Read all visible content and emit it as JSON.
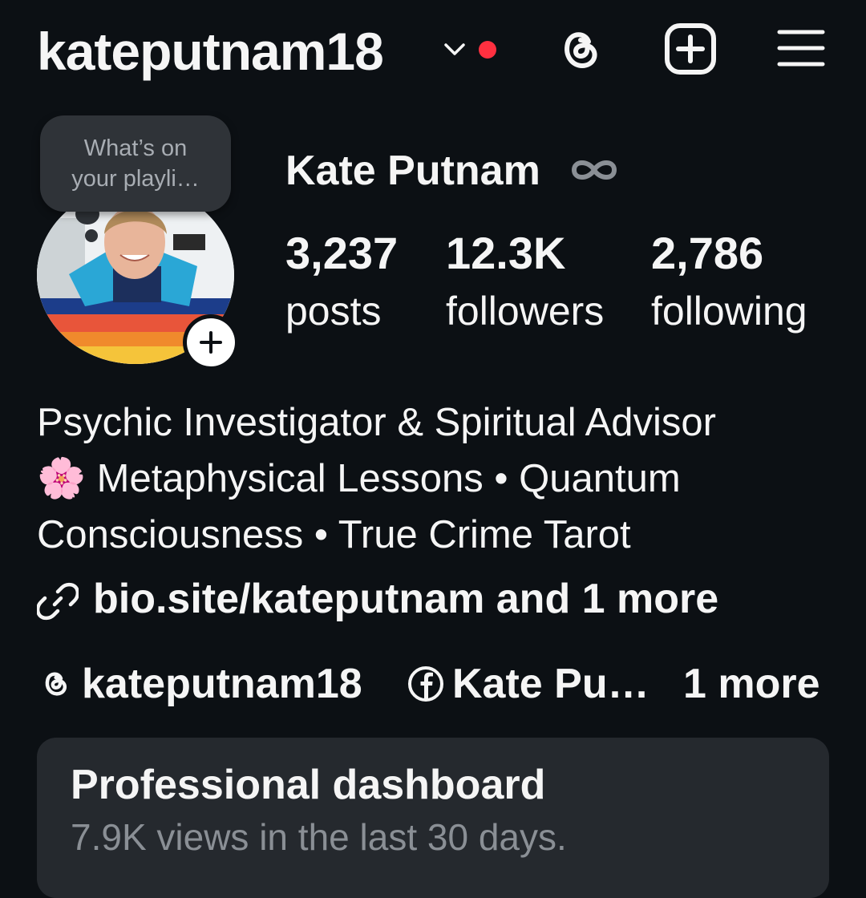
{
  "header": {
    "username": "kateputnam18",
    "has_notification_dot": true,
    "accent_red": "#ff3040"
  },
  "profile": {
    "note": "What’s on\nyour playli…",
    "display_name": "Kate Putnam",
    "badge_icon": "infinity-icon",
    "stats": [
      {
        "value": "3,237",
        "label": "posts"
      },
      {
        "value": "12.3K",
        "label": "followers"
      },
      {
        "value": "2,786",
        "label": "following"
      }
    ]
  },
  "bio": {
    "lines": [
      "Psychic Investigator & Spiritual Advisor",
      "🌸 Metaphysical Lessons • Quantum",
      "Consciousness • True Crime Tarot"
    ],
    "link": "bio.site/kateputnam and 1 more"
  },
  "social": {
    "threads_handle": "kateputnam18",
    "facebook_name": "Kate Pu…",
    "more": "1 more"
  },
  "dashboard": {
    "title": "Professional dashboard",
    "subtitle": "7.9K views in the last 30 days."
  },
  "colors": {
    "background": "#0c1014",
    "card": "#25292e",
    "note_bubble": "#2f3338"
  }
}
